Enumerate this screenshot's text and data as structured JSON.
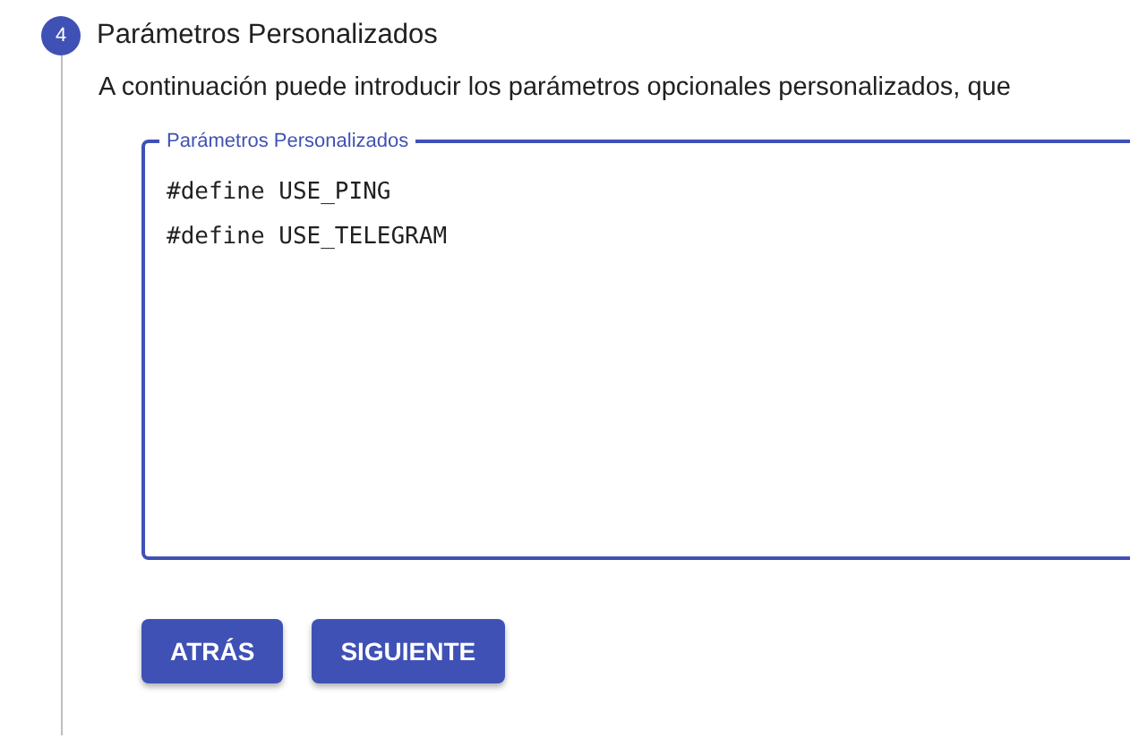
{
  "step": {
    "number": "4",
    "title": "Parámetros Personalizados",
    "description": "A continuación puede introducir los parámetros opcionales personalizados, que"
  },
  "field": {
    "label": "Parámetros Personalizados",
    "focused": true,
    "lines": [
      "#define USE_PING",
      "#define USE_TELEGRAM"
    ]
  },
  "buttons": [
    {
      "label": "ATRÁS"
    },
    {
      "label": "SIGUIENTE"
    }
  ]
}
